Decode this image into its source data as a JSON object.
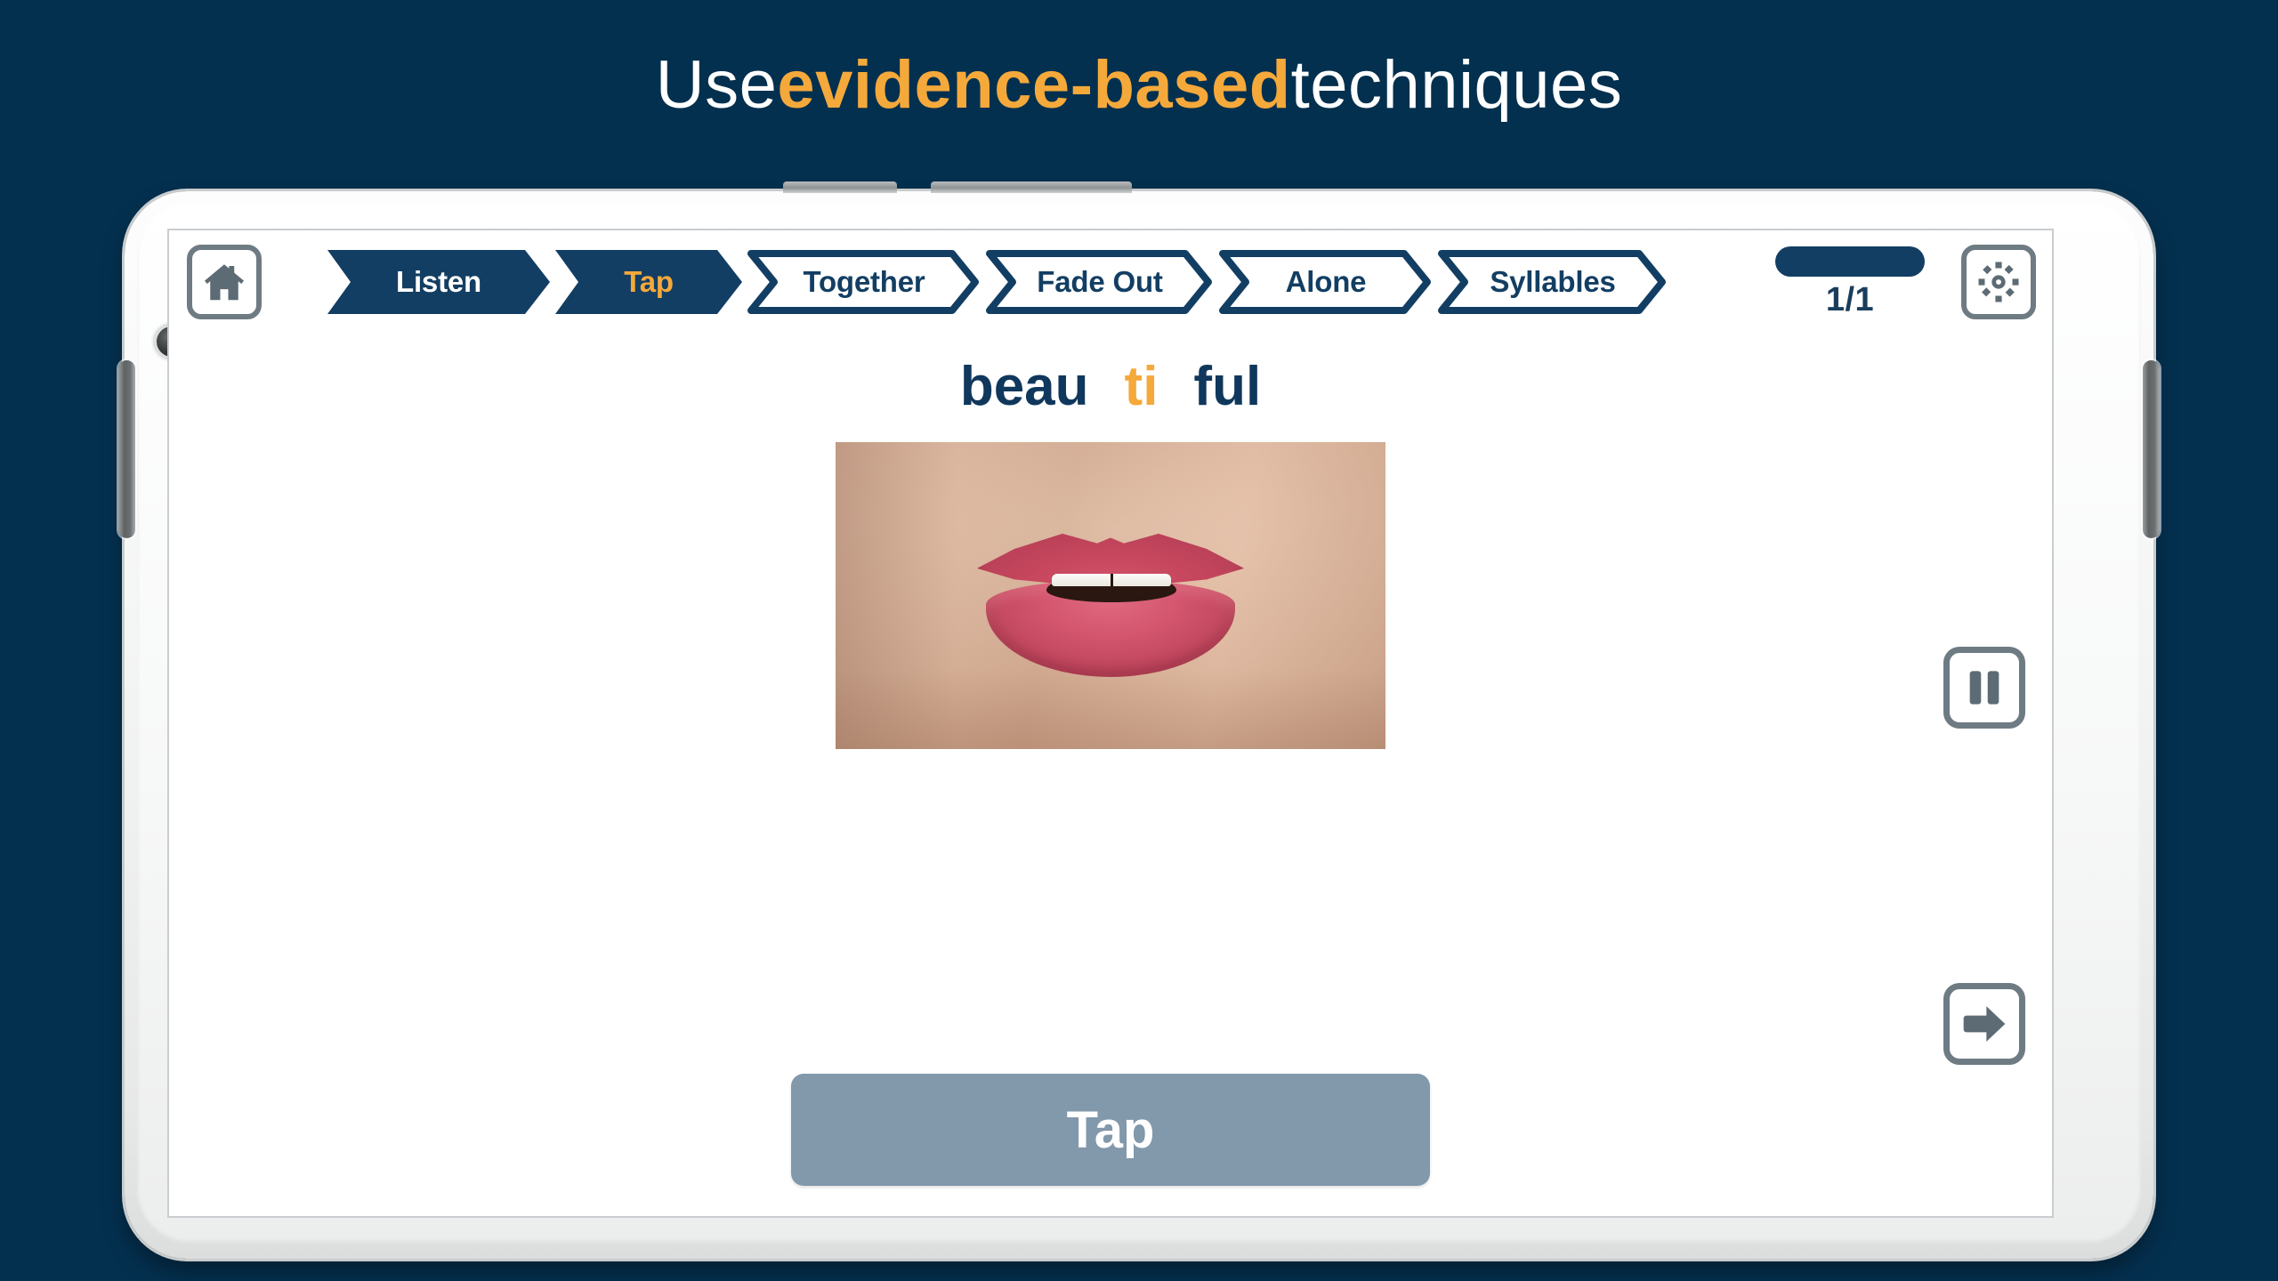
{
  "headline": {
    "part1": "Use ",
    "accent": "evidence-based",
    "part2": " techniques"
  },
  "colors": {
    "background": "#04304f",
    "accent_orange": "#f5a93b",
    "navy": "#133e63",
    "icon_grey": "#5d6b74",
    "button_grey_blue": "#8298ab"
  },
  "app": {
    "topbar": {
      "home_icon": "home-icon",
      "settings_icon": "gear-icon",
      "steps": [
        {
          "label": "Listen",
          "style": "filled",
          "active": false
        },
        {
          "label": "Tap",
          "style": "filled",
          "active": true
        },
        {
          "label": "Together",
          "style": "outline",
          "active": false
        },
        {
          "label": "Fade Out",
          "style": "outline",
          "active": false
        },
        {
          "label": "Alone",
          "style": "outline",
          "active": false
        },
        {
          "label": "Syllables",
          "style": "outline",
          "active": false
        }
      ],
      "progress": {
        "count": "1/1",
        "fill_percent": 100
      }
    },
    "word": {
      "syllables": [
        {
          "text": "beau",
          "highlighted": false
        },
        {
          "text": "ti",
          "highlighted": true
        },
        {
          "text": "ful",
          "highlighted": false
        }
      ]
    },
    "media": {
      "name": "mouth-articulation-video"
    },
    "action_button": {
      "label": "Tap"
    },
    "controls": {
      "pause_icon": "pause-icon",
      "next_icon": "arrow-right-icon"
    }
  }
}
